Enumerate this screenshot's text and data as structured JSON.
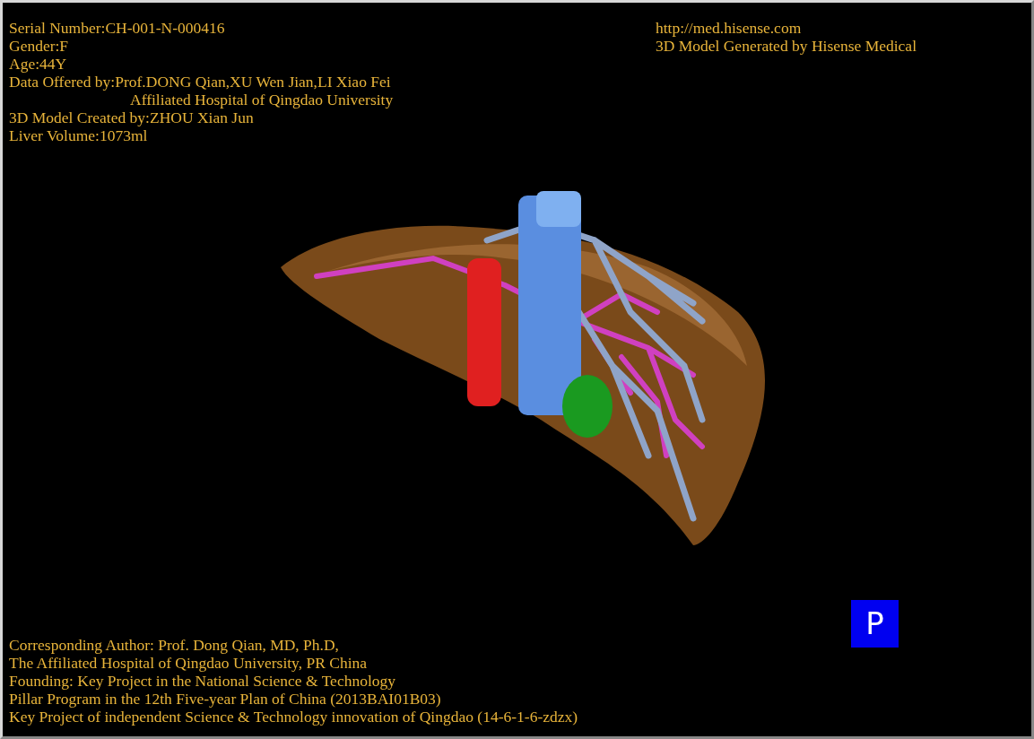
{
  "patient_info": [
    {
      "kind": "line",
      "text": "Serial Number:CH-001-N-000416"
    },
    {
      "kind": "line",
      "text": "Gender:F"
    },
    {
      "kind": "line",
      "text": "Age:44Y"
    },
    {
      "kind": "line",
      "text": "Data Offered by:Prof.DONG Qian,XU Wen Jian,LI Xiao Fei"
    },
    {
      "kind": "continuation",
      "text": "Affiliated Hospital of Qingdao University"
    },
    {
      "kind": "line",
      "text": "3D Model Created by:ZHOU Xian Jun"
    },
    {
      "kind": "line",
      "text": "Liver Volume:1073ml"
    }
  ],
  "vendor": {
    "url": "http://med.hisense.com",
    "caption": "3D Model Generated by Hisense Medical"
  },
  "credits": [
    "Corresponding Author: Prof. Dong Qian, MD, Ph.D,",
    "The Affiliated Hospital of Qingdao University, PR China",
    "Founding: Key Project in the National Science & Technology",
    "Pillar Program in the 12th Five-year Plan of China (2013BAI01B03)",
    "Key Project of independent Science & Technology innovation of Qingdao (14-6-1-6-zdzx)"
  ],
  "view_button": {
    "label": "P"
  }
}
